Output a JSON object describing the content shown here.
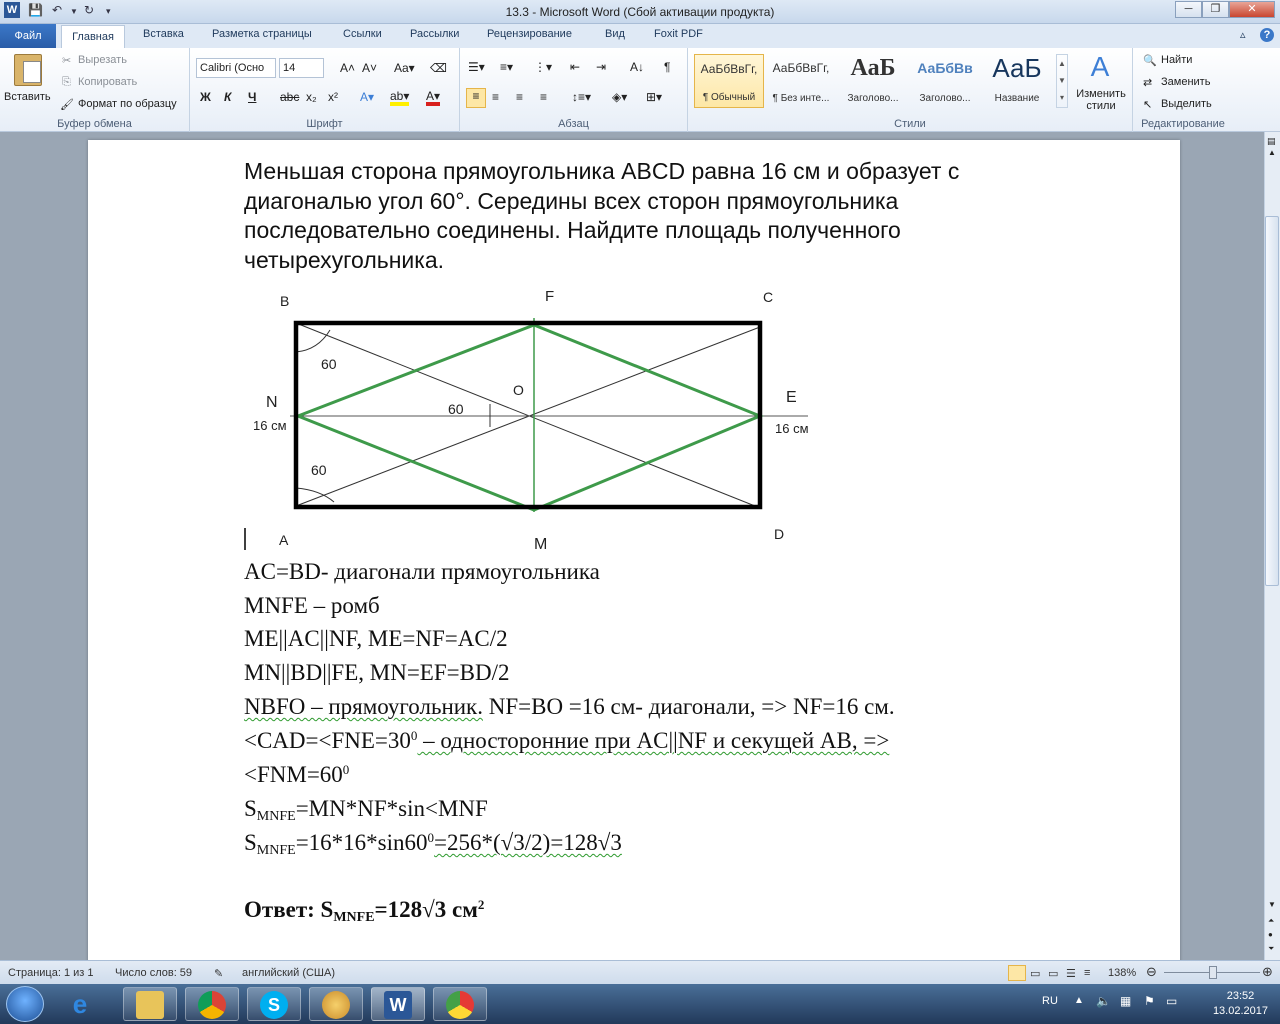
{
  "window": {
    "title": "13.3 - Microsoft Word (Сбой активации продукта)"
  },
  "tabs": [
    "Файл",
    "Главная",
    "Вставка",
    "Разметка страницы",
    "Ссылки",
    "Рассылки",
    "Рецензирование",
    "Вид",
    "Foxit PDF"
  ],
  "ribbon": {
    "clipboard": {
      "paste": "Вставить",
      "cut": "Вырезать",
      "copy": "Копировать",
      "format_painter": "Формат по образцу",
      "label": "Буфер обмена"
    },
    "font": {
      "name": "Calibri (Осно",
      "size": "14",
      "label": "Шрифт"
    },
    "paragraph": {
      "label": "Абзац"
    },
    "styles": {
      "items": [
        {
          "preview": "АаБбВвГг,",
          "caption": "¶ Обычный"
        },
        {
          "preview": "АаБбВвГг,",
          "caption": "¶ Без инте..."
        },
        {
          "preview": "АаБ",
          "caption": "Заголово..."
        },
        {
          "preview": "АаБбВв",
          "caption": "Заголово..."
        },
        {
          "preview": "АаБ",
          "caption": "Название"
        }
      ],
      "change": "Изменить стили",
      "label": "Стили"
    },
    "editing": {
      "find": "Найти",
      "replace": "Заменить",
      "select": "Выделить",
      "label": "Редактирование"
    }
  },
  "document": {
    "task": "Меньшая сторона прямоугольника ABCD равна 16 см и образует с диагональю угол 60°. Середины всех сторон прямоугольника последовательно соединены. Найдите площадь полученного четырехугольника.",
    "figure": {
      "labels": {
        "B": "B",
        "F": "F",
        "C": "C",
        "N": "N",
        "O": "O",
        "E": "E",
        "A": "A",
        "M": "M",
        "D": "D"
      },
      "angle_labels": [
        "60",
        "60",
        "60"
      ],
      "side_labels": [
        "16 см",
        "16 см"
      ]
    },
    "lines": {
      "l1": "AC=BD- диагонали прямоугольника",
      "l2": "MNFE – ромб",
      "l3": "ME||AC||NF, ME=NF=AC/2",
      "l4": "MN||BD||FE, MN=EF=BD/2",
      "l5a": "NBFO – прямоугольник.",
      "l5b": "NF=BO =16  см- диагонали, => NF=16 см.",
      "l6a": "<CAD=<FNE=30",
      "l6sup": "0",
      "l6b": " – односторонние при AC||NF и секущей AB, =>",
      "l7a": "<FNM=60",
      "l7sup": "0",
      "l8s": "S",
      "l8sub": "MNFE",
      "l8b": "=MN*NF*sin<MNF",
      "l9s": "S",
      "l9sub": "MNFE",
      "l9b": "=16*16*sin60",
      "l9sup": "0",
      "l9c": "=256*(√3/2)=128√3",
      "ans_label": "Ответ:",
      "ans_s": "S",
      "ans_sub": "MNFE",
      "ans_val": "=128√3 см",
      "ans_sup": "2"
    }
  },
  "status": {
    "page": "Страница: 1 из 1",
    "words": "Число слов: 59",
    "lang": "английский (США)",
    "zoom": "138%"
  },
  "taskbar": {
    "lang": "RU",
    "time": "23:52",
    "date": "13.02.2017"
  },
  "colors": {
    "rhombus": "#3e9a4a",
    "ribbon_accent": "#2a5da8"
  }
}
